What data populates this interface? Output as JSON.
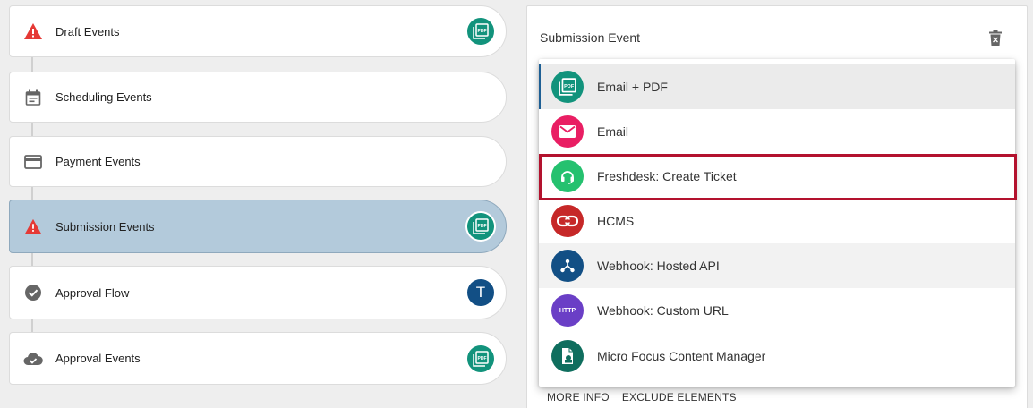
{
  "events": [
    {
      "label": "Draft Events",
      "icon": "warning-icon",
      "badge": "pdf"
    },
    {
      "label": "Scheduling Events",
      "icon": "calendar-icon",
      "badge": ""
    },
    {
      "label": "Payment Events",
      "icon": "credit-card-icon",
      "badge": ""
    },
    {
      "label": "Submission Events",
      "icon": "warning-icon",
      "badge": "pdf",
      "selected": true
    },
    {
      "label": "Approval Flow",
      "icon": "check-circle-icon",
      "badge": "T"
    },
    {
      "label": "Approval Events",
      "icon": "cloud-check-icon",
      "badge": "pdf"
    }
  ],
  "panel": {
    "title": "Submission Event",
    "footer": {
      "more_info": "MORE INFO",
      "exclude": "EXCLUDE ELEMENTS"
    }
  },
  "dropdown": {
    "items": [
      {
        "label": "Email + PDF",
        "icon": "pdf-icon",
        "color": "#12937c",
        "state": "active"
      },
      {
        "label": "Email",
        "icon": "mail-icon",
        "color": "#e91e63"
      },
      {
        "label": "Freshdesk: Create Ticket",
        "icon": "headset-icon",
        "color": "#25c16f",
        "highlighted": true
      },
      {
        "label": "HCMS",
        "icon": "hcms-logo-icon",
        "color": "#c62828"
      },
      {
        "label": "Webhook: Hosted API",
        "icon": "webhook-icon",
        "color": "#124f85",
        "state": "hover"
      },
      {
        "label": "Webhook: Custom URL",
        "icon": "http-icon",
        "color": "#6a3fc6"
      },
      {
        "label": "Micro Focus Content Manager",
        "icon": "document-icon",
        "color": "#0f6e5e"
      }
    ],
    "http_text": "HTTP",
    "pdf_text": "PDF"
  },
  "colors": {
    "warning": "#e53935",
    "selected_bg": "#b3cadb",
    "highlight": "#b3122e"
  }
}
